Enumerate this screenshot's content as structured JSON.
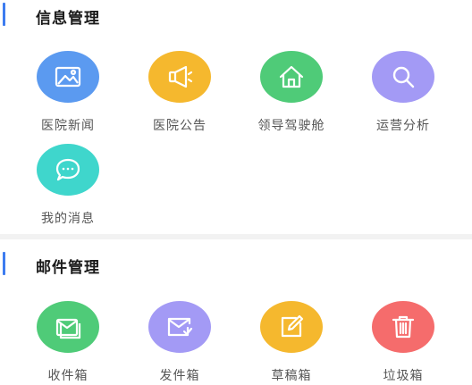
{
  "info_section": {
    "title": "信息管理",
    "items": [
      {
        "label": "医院新闻",
        "icon": "image-icon",
        "color": "#5b9af0"
      },
      {
        "label": "医院公告",
        "icon": "megaphone-icon",
        "color": "#f5b82e"
      },
      {
        "label": "领导驾驶舱",
        "icon": "home-icon",
        "color": "#4fcb78"
      },
      {
        "label": "运营分析",
        "icon": "search-icon",
        "color": "#a39af5"
      },
      {
        "label": "我的消息",
        "icon": "chat-bubble-icon",
        "color": "#3fd6cc"
      }
    ]
  },
  "mail_section": {
    "title": "邮件管理",
    "items": [
      {
        "label": "收件箱",
        "icon": "inbox-icon",
        "color": "#4fcb78"
      },
      {
        "label": "发件箱",
        "icon": "outbox-icon",
        "color": "#a39af5"
      },
      {
        "label": "草稿箱",
        "icon": "edit-icon",
        "color": "#f5b82e"
      },
      {
        "label": "垃圾箱",
        "icon": "trash-icon",
        "color": "#f56c6c"
      }
    ]
  }
}
